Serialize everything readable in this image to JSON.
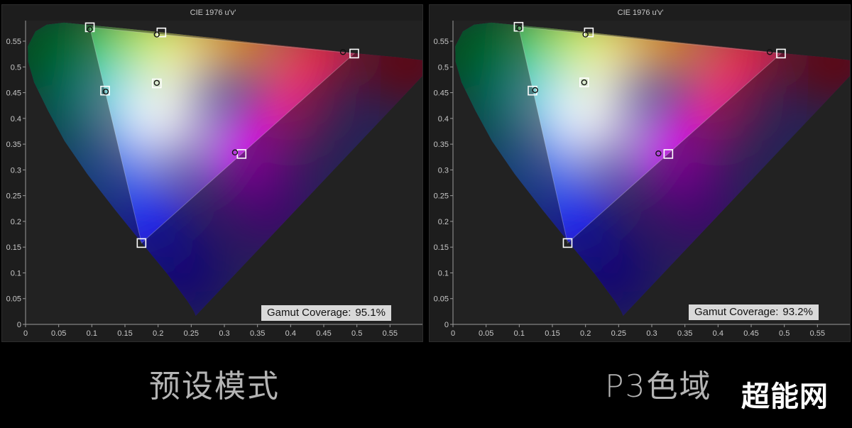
{
  "chart_data": [
    {
      "type": "scatter",
      "title": "CIE 1976 u'v'",
      "xlim": [
        0,
        0.6
      ],
      "ylim": [
        0,
        0.59
      ],
      "x_ticks": [
        "0",
        "0.05",
        "0.1",
        "0.15",
        "0.2",
        "0.25",
        "0.3",
        "0.35",
        "0.4",
        "0.45",
        "0.5",
        "0.55"
      ],
      "y_ticks": [
        "0",
        "0.05",
        "0.1",
        "0.15",
        "0.2",
        "0.25",
        "0.3",
        "0.35",
        "0.4",
        "0.45",
        "0.5",
        "0.55"
      ],
      "triangle": [
        [
          0.097,
          0.577
        ],
        [
          0.175,
          0.158
        ],
        [
          0.496,
          0.526
        ]
      ],
      "target_points": [
        [
          0.097,
          0.577
        ],
        [
          0.205,
          0.567
        ],
        [
          0.496,
          0.526
        ],
        [
          0.326,
          0.331
        ],
        [
          0.175,
          0.158
        ],
        [
          0.12,
          0.454
        ],
        [
          0.198,
          0.468
        ]
      ],
      "measured_points": [
        [
          0.097,
          0.573
        ],
        [
          0.198,
          0.563
        ],
        [
          0.479,
          0.529
        ],
        [
          0.316,
          0.334
        ],
        [
          0.121,
          0.452
        ],
        [
          0.198,
          0.469
        ]
      ],
      "coverage_label": "Gamut Coverage:",
      "coverage_value": "95.1%",
      "caption": "预设模式"
    },
    {
      "type": "scatter",
      "title": "CIE 1976 u'v'",
      "xlim": [
        0,
        0.6
      ],
      "ylim": [
        0,
        0.59
      ],
      "x_ticks": [
        "0",
        "0.05",
        "0.1",
        "0.15",
        "0.2",
        "0.25",
        "0.3",
        "0.35",
        "0.4",
        "0.45",
        "0.5",
        "0.55"
      ],
      "y_ticks": [
        "0",
        "0.05",
        "0.1",
        "0.15",
        "0.2",
        "0.25",
        "0.3",
        "0.35",
        "0.4",
        "0.45",
        "0.5",
        "0.55"
      ],
      "triangle": [
        [
          0.099,
          0.578
        ],
        [
          0.173,
          0.158
        ],
        [
          0.495,
          0.526
        ]
      ],
      "target_points": [
        [
          0.099,
          0.578
        ],
        [
          0.205,
          0.567
        ],
        [
          0.495,
          0.526
        ],
        [
          0.325,
          0.331
        ],
        [
          0.173,
          0.158
        ],
        [
          0.12,
          0.454
        ],
        [
          0.198,
          0.47
        ]
      ],
      "measured_points": [
        [
          0.1,
          0.575
        ],
        [
          0.2,
          0.563
        ],
        [
          0.478,
          0.529
        ],
        [
          0.31,
          0.332
        ],
        [
          0.124,
          0.455
        ],
        [
          0.198,
          0.47
        ]
      ],
      "coverage_label": "Gamut Coverage:",
      "coverage_value": "93.2%",
      "caption": "P3色域"
    }
  ],
  "watermark": "超能网"
}
